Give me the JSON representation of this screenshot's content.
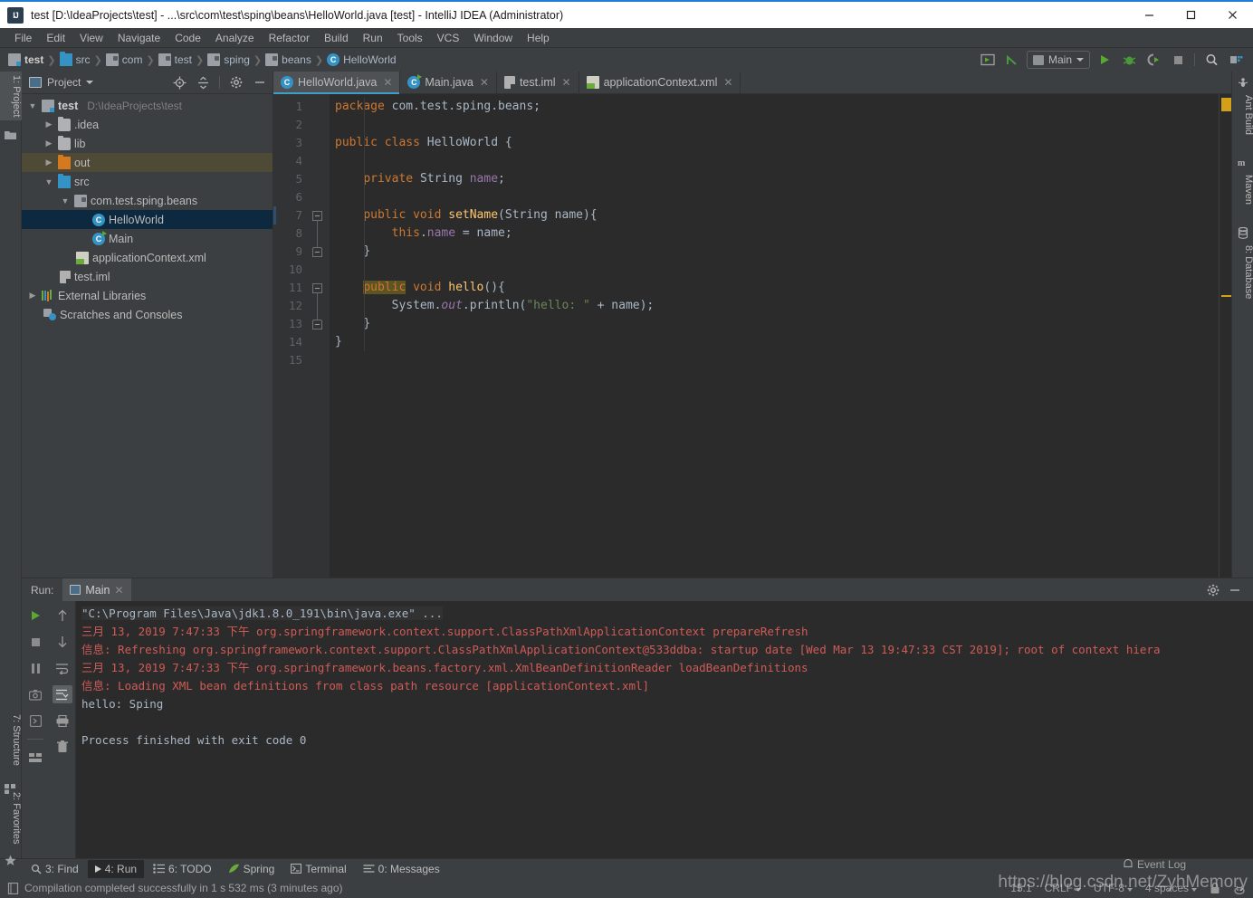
{
  "window": {
    "title": "test [D:\\IdeaProjects\\test] - ...\\src\\com\\test\\sping\\beans\\HelloWorld.java [test] - IntelliJ IDEA (Administrator)",
    "minimize": "–",
    "maximize": "□",
    "close": "✕"
  },
  "menu": [
    "File",
    "Edit",
    "View",
    "Navigate",
    "Code",
    "Analyze",
    "Refactor",
    "Build",
    "Run",
    "Tools",
    "VCS",
    "Window",
    "Help"
  ],
  "breadcrumb": [
    {
      "label": "test",
      "icon": "module-icon",
      "bold": true
    },
    {
      "label": "src",
      "icon": "source-folder-icon",
      "bold": false
    },
    {
      "label": "com",
      "icon": "package-icon",
      "bold": false
    },
    {
      "label": "test",
      "icon": "package-icon",
      "bold": false
    },
    {
      "label": "sping",
      "icon": "package-icon",
      "bold": false
    },
    {
      "label": "beans",
      "icon": "package-icon",
      "bold": false
    },
    {
      "label": "HelloWorld",
      "icon": "class-icon",
      "bold": false
    }
  ],
  "toolbar": {
    "run_configuration": "Main",
    "buttons": [
      "build-project-icon",
      "update-project-icon",
      "run-icon",
      "debug-icon",
      "run-with-coverage-icon",
      "stop-icon",
      "search-everywhere-icon",
      "project-structure-icon"
    ]
  },
  "left_strip": [
    {
      "label": "1: Project",
      "selected": true
    },
    {
      "label": "7: Structure",
      "selected": false
    },
    {
      "label": "2: Favorites",
      "selected": false
    }
  ],
  "right_strip": [
    {
      "label": "Ant Build"
    },
    {
      "label": "Maven"
    },
    {
      "label": "8: Database"
    }
  ],
  "project_panel": {
    "title": "Project",
    "tree": [
      {
        "depth": 0,
        "arrow": "▼",
        "icon": "module-icon",
        "label": "test",
        "bold": true,
        "path": "D:\\IdeaProjects\\test",
        "state": "none"
      },
      {
        "depth": 1,
        "arrow": "▶",
        "icon": "folder-icon",
        "label": ".idea",
        "bold": false,
        "path": "",
        "state": "none"
      },
      {
        "depth": 1,
        "arrow": "▶",
        "icon": "folder-icon",
        "label": "lib",
        "bold": false,
        "path": "",
        "state": "none"
      },
      {
        "depth": 1,
        "arrow": "▶",
        "icon": "folder-orange-icon",
        "label": "out",
        "bold": false,
        "path": "",
        "state": "highlight"
      },
      {
        "depth": 1,
        "arrow": "▼",
        "icon": "source-folder-icon",
        "label": "src",
        "bold": false,
        "path": "",
        "state": "none"
      },
      {
        "depth": 2,
        "arrow": "▼",
        "icon": "package-icon",
        "label": "com.test.sping.beans",
        "bold": false,
        "path": "",
        "state": "none"
      },
      {
        "depth": 3,
        "arrow": "",
        "icon": "class-icon",
        "label": "HelloWorld",
        "bold": false,
        "path": "",
        "state": "selected"
      },
      {
        "depth": 3,
        "arrow": "",
        "icon": "runnable-class-icon",
        "label": "Main",
        "bold": false,
        "path": "",
        "state": "none"
      },
      {
        "depth": 2,
        "arrow": "",
        "icon": "xml-icon",
        "label": "applicationContext.xml",
        "bold": false,
        "path": "",
        "state": "none"
      },
      {
        "depth": 1,
        "arrow": "",
        "icon": "iml-icon",
        "label": "test.iml",
        "bold": false,
        "path": "",
        "state": "none"
      },
      {
        "depth": 0,
        "arrow": "▶",
        "icon": "libraries-icon",
        "label": "External Libraries",
        "bold": false,
        "path": "",
        "state": "none"
      },
      {
        "depth": 0,
        "arrow": "",
        "icon": "scratches-icon",
        "label": "Scratches and Consoles",
        "bold": false,
        "path": "",
        "state": "none"
      }
    ]
  },
  "editor": {
    "tabs": [
      {
        "label": "HelloWorld.java",
        "icon": "class-icon",
        "active": true
      },
      {
        "label": "Main.java",
        "icon": "runnable-class-icon",
        "active": false
      },
      {
        "label": "test.iml",
        "icon": "iml-icon",
        "active": false
      },
      {
        "label": "applicationContext.xml",
        "icon": "xml-icon",
        "active": false
      }
    ],
    "line_numbers": [
      "1",
      "2",
      "3",
      "4",
      "5",
      "6",
      "7",
      "8",
      "9",
      "10",
      "11",
      "12",
      "13",
      "14",
      "15"
    ],
    "code_lines": [
      "package com.test.sping.beans;",
      "",
      "public class HelloWorld {",
      "",
      "    private String name;",
      "",
      "    public void setName(String name){",
      "        this.name = name;",
      "    }",
      "",
      "    public void hello(){",
      "        System.out.println(\"hello: \" + name);",
      "    }",
      "}",
      ""
    ]
  },
  "run_panel": {
    "label": "Run:",
    "tab": "Main",
    "console_lines": [
      {
        "text": "\"C:\\Program Files\\Java\\jdk1.8.0_191\\bin\\java.exe\" ...",
        "type": "sys"
      },
      {
        "text": "三月 13, 2019 7:47:33 下午 org.springframework.context.support.ClassPathXmlApplicationContext prepareRefresh",
        "type": "err"
      },
      {
        "text": "信息: Refreshing org.springframework.context.support.ClassPathXmlApplicationContext@533ddba: startup date [Wed Mar 13 19:47:33 CST 2019]; root of context hiera",
        "type": "err"
      },
      {
        "text": "三月 13, 2019 7:47:33 下午 org.springframework.beans.factory.xml.XmlBeanDefinitionReader loadBeanDefinitions",
        "type": "err"
      },
      {
        "text": "信息: Loading XML bean definitions from class path resource [applicationContext.xml]",
        "type": "err"
      },
      {
        "text": "hello: Sping",
        "type": "out"
      },
      {
        "text": "",
        "type": "out"
      },
      {
        "text": "Process finished with exit code 0",
        "type": "out"
      }
    ]
  },
  "status_strip": [
    {
      "label": "3: Find",
      "icon": "search-icon",
      "active": false
    },
    {
      "label": "4: Run",
      "icon": "run-icon",
      "active": true
    },
    {
      "label": "6: TODO",
      "icon": "todo-icon",
      "active": false
    },
    {
      "label": "Spring",
      "icon": "spring-icon",
      "active": false
    },
    {
      "label": "Terminal",
      "icon": "terminal-icon",
      "active": false
    },
    {
      "label": "0: Messages",
      "icon": "messages-icon",
      "active": false
    }
  ],
  "status_bar": {
    "message": "Compilation completed successfully in 1 s 532 ms (3 minutes ago)",
    "event_log": "Event Log",
    "caret_position": "15:1",
    "line_separator": "CRLF",
    "encoding": "UTF-8",
    "indent": "4 spaces"
  },
  "watermark": "https://blog.csdn.net/ZyhMemory",
  "colors": {
    "accent": "#3d9ec9",
    "panel": "#3c3f41",
    "editor_bg": "#2b2b2b",
    "selection": "#0d293f",
    "highlight": "#4e4a36",
    "error_text": "#cf5b56",
    "keyword": "#cc7832",
    "string": "#6a8759",
    "field": "#9876aa",
    "method": "#ffc66d",
    "green": "#5aa832",
    "title_border": "#1c7fd4"
  }
}
